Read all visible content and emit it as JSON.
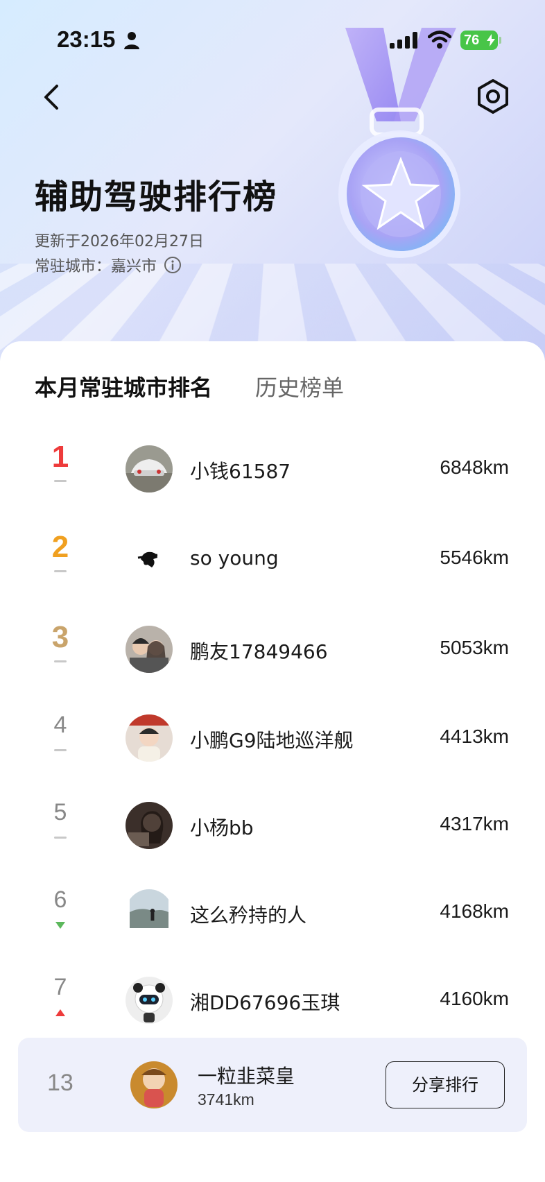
{
  "status_bar": {
    "time": "23:15",
    "battery": "76"
  },
  "header": {
    "title": "辅助驾驶排行榜",
    "updated": "更新于2026年02月27日",
    "city_label": "常驻城市：",
    "city": "嘉兴市"
  },
  "tabs": [
    {
      "label": "本月常驻城市排名",
      "active": true
    },
    {
      "label": "历史榜单",
      "active": false
    }
  ],
  "rankings": [
    {
      "rank": "1",
      "name": "小钱61587",
      "distance": "6848km",
      "trend": "flat"
    },
    {
      "rank": "2",
      "name": "so young",
      "distance": "5546km",
      "trend": "flat"
    },
    {
      "rank": "3",
      "name": "鹏友17849466",
      "distance": "5053km",
      "trend": "flat"
    },
    {
      "rank": "4",
      "name": "小鹏G9陆地巡洋舰",
      "distance": "4413km",
      "trend": "flat"
    },
    {
      "rank": "5",
      "name": "小杨bb",
      "distance": "4317km",
      "trend": "flat"
    },
    {
      "rank": "6",
      "name": "这么矜持的人",
      "distance": "4168km",
      "trend": "down"
    },
    {
      "rank": "7",
      "name": "湘DD67696玉琪",
      "distance": "4160km",
      "trend": "up"
    }
  ],
  "me": {
    "rank": "13",
    "name": "一粒韭菜皇",
    "distance": "3741km"
  },
  "share_label": "分享排行",
  "colors": {
    "rank1": "#ee3b3b",
    "rank2": "#f0a020",
    "rank3": "#c9a46b",
    "trend_up": "#ee3b3b",
    "trend_down": "#5cb85c",
    "battery": "#48c548"
  }
}
